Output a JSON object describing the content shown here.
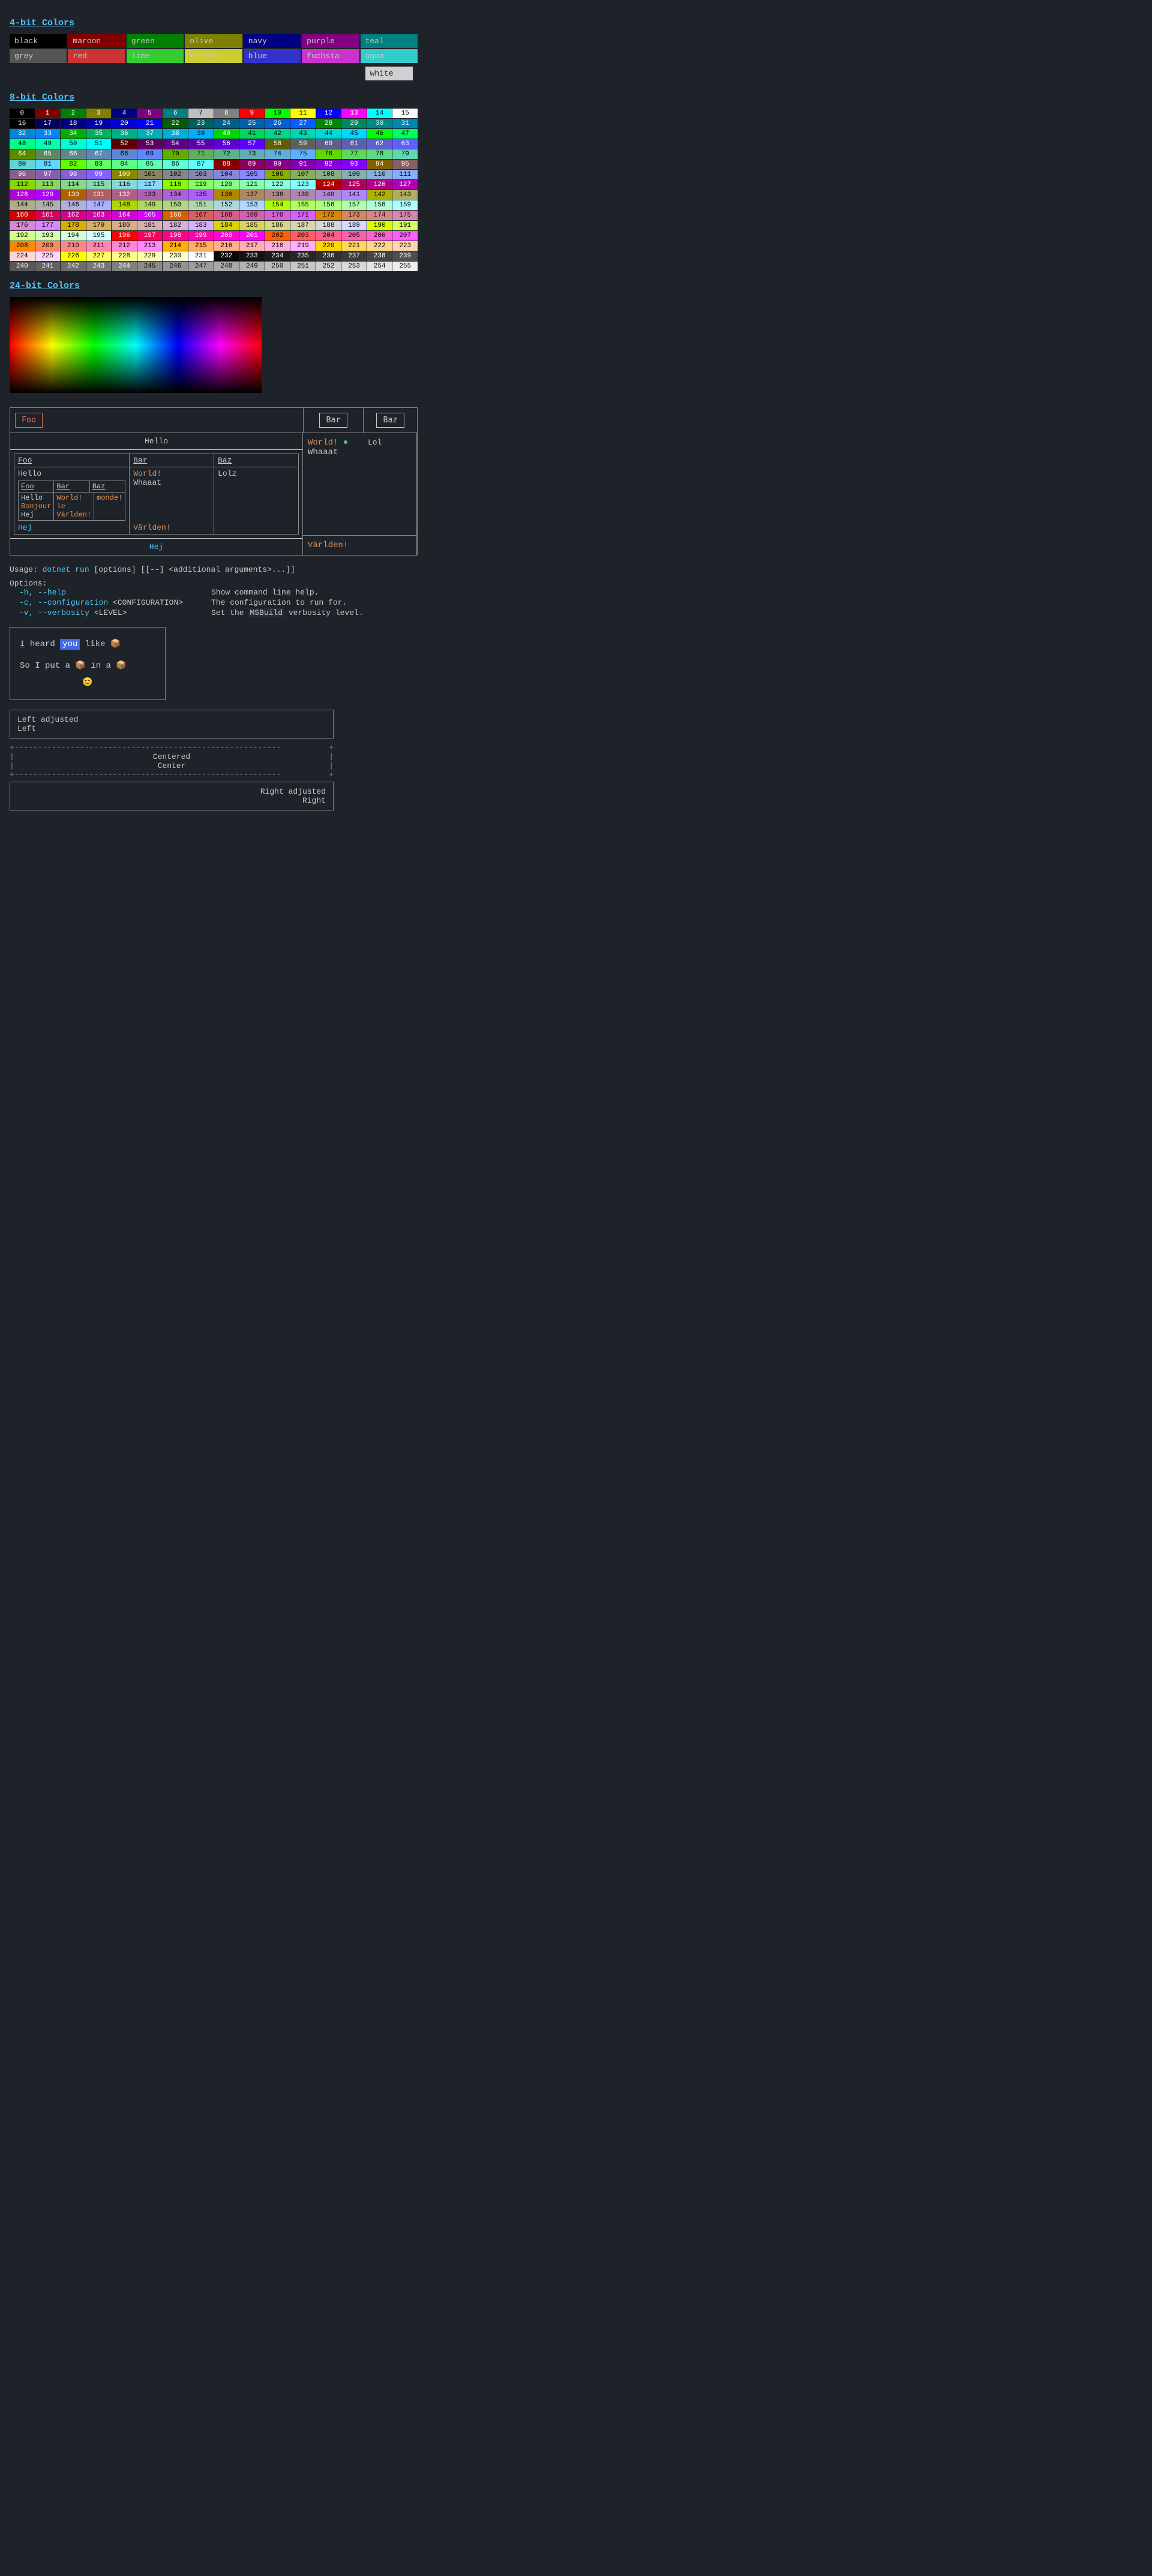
{
  "sections": {
    "four_bit_title": "4-bit Colors",
    "eight_bit_title": "8-bit Colors",
    "twenty_four_bit_title": "24-bit Colors"
  },
  "four_bit_colors": [
    {
      "label": "black",
      "bg": "#000000",
      "fg": "#c8c8c8"
    },
    {
      "label": "maroon\nred",
      "bg": "#800000",
      "fg": "#c8c8c8"
    },
    {
      "label": "green\nlime",
      "bg": "#008000",
      "fg": "#c8c8c8"
    },
    {
      "label": "olive\nyellow",
      "bg": "#808000",
      "fg": "#c8c8c8"
    },
    {
      "label": "navy\nblue",
      "bg": "#000080",
      "fg": "#c8c8c8"
    },
    {
      "label": "purple\nfuchsia",
      "bg": "#800080",
      "fg": "#c8c8c8"
    },
    {
      "label": "teal\naqua",
      "bg": "#008080",
      "fg": "#c8c8c8"
    },
    {
      "label": "grey",
      "bg": "#303030",
      "fg": "#c8c8c8"
    },
    {
      "label": "",
      "bg": "#cc0000",
      "fg": "#c8c8c8"
    },
    {
      "label": "",
      "bg": "#00cc00",
      "fg": "#c8c8c8"
    },
    {
      "label": "",
      "bg": "#cccc00",
      "fg": "#c8c8c8"
    },
    {
      "label": "",
      "bg": "#0000cc",
      "fg": "#c8c8c8"
    },
    {
      "label": "",
      "bg": "#cc00cc",
      "fg": "#c8c8c8"
    },
    {
      "label": "",
      "bg": "#00cccc",
      "fg": "#c8c8c8"
    },
    {
      "label": "white",
      "bg": "#d0d0d0",
      "fg": "#222222"
    }
  ],
  "table_ui": {
    "foo_btn": "Foo",
    "bar_btn": "Bar",
    "baz_btn": "Baz",
    "hello_header": "Hello",
    "hej_footer": "Hej",
    "col_headers": [
      "Foo",
      "Bar",
      "Baz"
    ],
    "row1": {
      "col1": "Hello",
      "col2_label": "World!",
      "col2_sub": "Whaaat",
      "col3": "Lolz"
    },
    "nested": {
      "headers": [
        "Foo",
        "Bar",
        "Baz"
      ],
      "rows": [
        {
          "col1": "Hello",
          "col2": "World!\nle\nVärlden!",
          "col3": "monde!"
        }
      ]
    },
    "hej_cell": "Hej",
    "varlden_cell": "Världen!",
    "right_top_world": "World!",
    "right_top_dot": "●",
    "right_top_whaaat": "Whaaat",
    "right_top_lol": "Lol",
    "right_bottom_varlden": "Världen!"
  },
  "usage": {
    "line": "Usage: dotnet run [options] [[--] <additional arguments>...]]",
    "options_label": "Options:",
    "opts": [
      {
        "left": "  -h, --help",
        "right": "Show command line help."
      },
      {
        "left": "  -c, --configuration <CONFIGURATION>",
        "right": "The configuration to run for."
      },
      {
        "left": "  -v, --verbosity <LEVEL>",
        "right": "Set the MSBuild verbosity level."
      }
    ]
  },
  "markup_box": {
    "line1_before": "I heard ",
    "line1_highlight": "you",
    "line1_after": " like 📦",
    "line2_before": "So I put a 📦 in a 📦",
    "line3": "😊"
  },
  "left_box": {
    "line1": "Left adjusted",
    "line2": "Left"
  },
  "center_box": {
    "line1": "Centered",
    "line2": "Center"
  },
  "right_box": {
    "line1": "Right adjusted",
    "line2": "Right"
  }
}
